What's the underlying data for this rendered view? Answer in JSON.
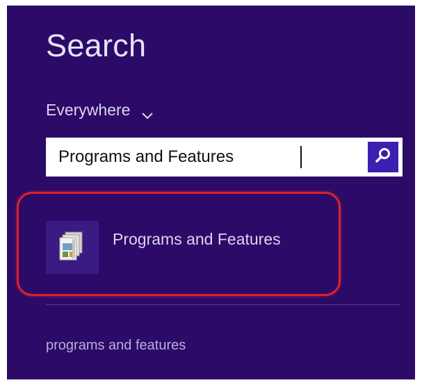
{
  "search_panel": {
    "title": "Search",
    "scope_label": "Everywhere",
    "query_value": "Programs and Features",
    "search_button_icon": "magnifier-icon",
    "results": [
      {
        "label": "Programs and Features",
        "icon": "programs-and-features-icon"
      }
    ],
    "suggestions": [
      "programs and features"
    ]
  },
  "colors": {
    "panel_background": "#2b0a68",
    "search_button": "#3b1fb0",
    "highlight": "#e0202a"
  }
}
